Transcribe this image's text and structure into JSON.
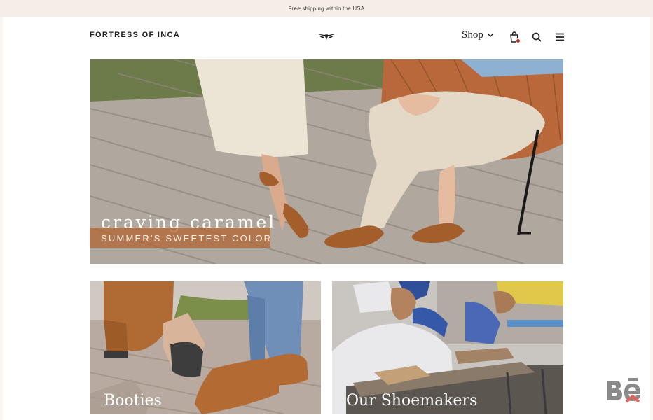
{
  "announcement": "Free shipping within the USA",
  "header": {
    "brand": "FORTRESS OF INCA",
    "logo_icon": "winged-logo-icon",
    "nav": {
      "shop_label": "Shop"
    },
    "icons": [
      "shopping-bag-icon",
      "search-icon",
      "hamburger-menu-icon"
    ]
  },
  "hero": {
    "title": "craving caramel",
    "subtitle": "SUMMER'S SWEETEST COLOR"
  },
  "tiles": [
    {
      "label": "Booties"
    },
    {
      "label": "Our Shoemakers"
    }
  ],
  "watermark": {
    "icon": "behance-icon"
  },
  "colors": {
    "background": "#fbf6f1",
    "banner_band": "#b26837",
    "cart_badge": "#c4342b",
    "watermark": "#8a8a8a",
    "watermark_accent": "#e0625a"
  }
}
